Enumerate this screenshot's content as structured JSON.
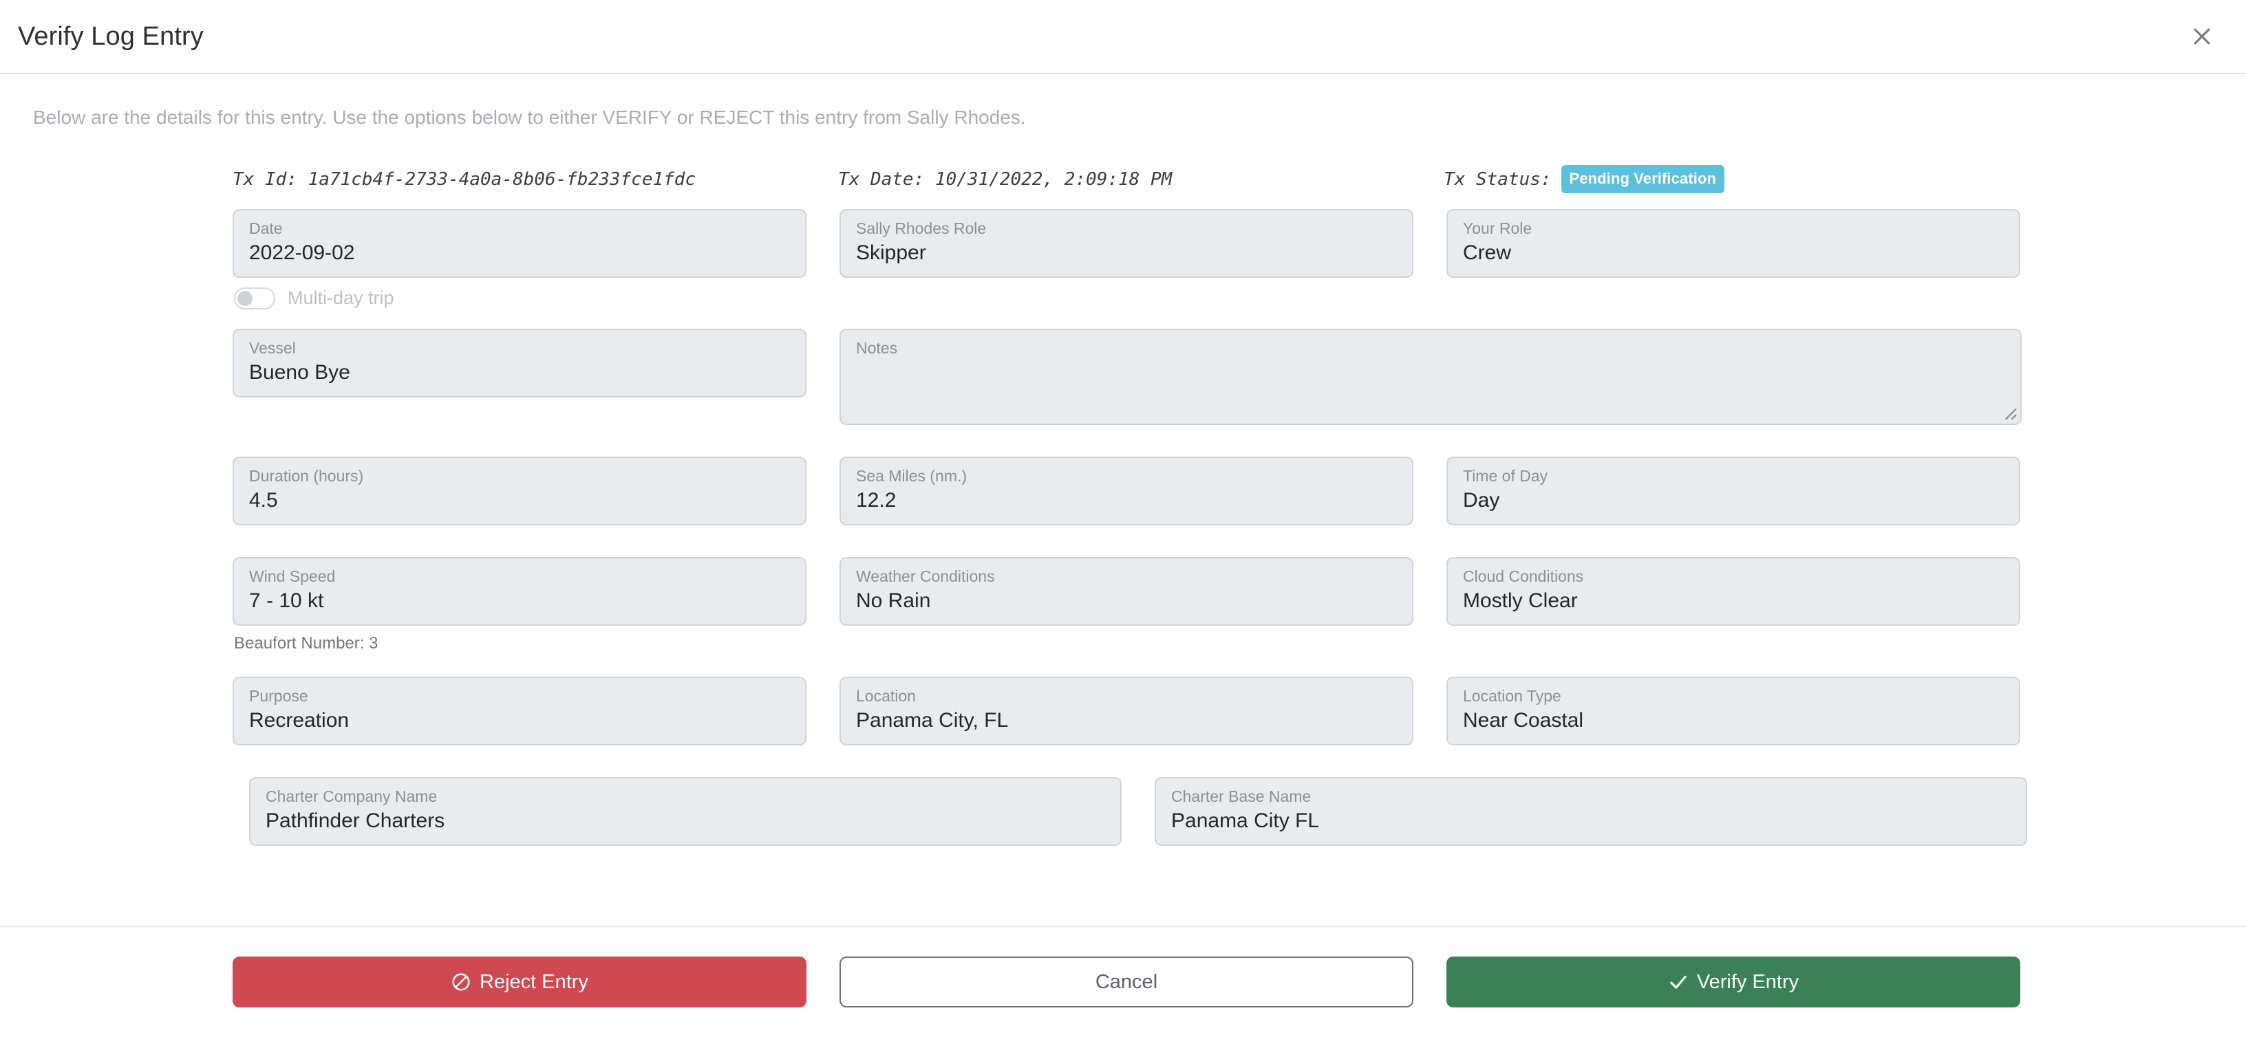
{
  "header": {
    "title": "Verify Log Entry",
    "close_icon": "close-icon"
  },
  "body": {
    "intro": "Below are the details for this entry. Use the options below to either VERIFY or REJECT this entry from Sally Rhodes."
  },
  "tx": {
    "id_label": "Tx Id:",
    "id_value": "1a71cb4f-2733-4a0a-8b06-fb233fce1fdc",
    "date_label": "Tx Date:",
    "date_value": "10/31/2022, 2:09:18 PM",
    "status_label": "Tx Status:",
    "status_value": "Pending Verification",
    "status_color": "#5bc0de"
  },
  "fields": {
    "date": {
      "label": "Date",
      "value": "2022-09-02"
    },
    "multi_day": {
      "label": "Multi-day trip",
      "checked": false
    },
    "sally_role": {
      "label": "Sally Rhodes Role",
      "value": "Skipper"
    },
    "your_role": {
      "label": "Your Role",
      "value": "Crew"
    },
    "vessel": {
      "label": "Vessel",
      "value": "Bueno Bye"
    },
    "notes": {
      "label": "Notes",
      "value": ""
    },
    "duration": {
      "label": "Duration (hours)",
      "value": "4.5"
    },
    "sea_miles": {
      "label": "Sea Miles (nm.)",
      "value": "12.2"
    },
    "time_of_day": {
      "label": "Time of Day",
      "value": "Day"
    },
    "wind_speed": {
      "label": "Wind Speed",
      "value": "7 - 10 kt"
    },
    "weather": {
      "label": "Weather Conditions",
      "value": "No Rain"
    },
    "cloud": {
      "label": "Cloud Conditions",
      "value": "Mostly Clear"
    },
    "beaufort": "Beaufort Number: 3",
    "purpose": {
      "label": "Purpose",
      "value": "Recreation"
    },
    "location": {
      "label": "Location",
      "value": "Panama City, FL"
    },
    "location_type": {
      "label": "Location Type",
      "value": "Near Coastal"
    },
    "charter_company": {
      "label": "Charter Company Name",
      "value": "Pathfinder Charters"
    },
    "charter_base": {
      "label": "Charter Base Name",
      "value": "Panama City FL"
    }
  },
  "footer": {
    "reject_label": "Reject Entry",
    "reject_icon": "ban-icon",
    "reject_color": "#cf4a50",
    "cancel_label": "Cancel",
    "verify_label": "Verify Entry",
    "verify_icon": "check-icon",
    "verify_color": "#3b8156"
  }
}
